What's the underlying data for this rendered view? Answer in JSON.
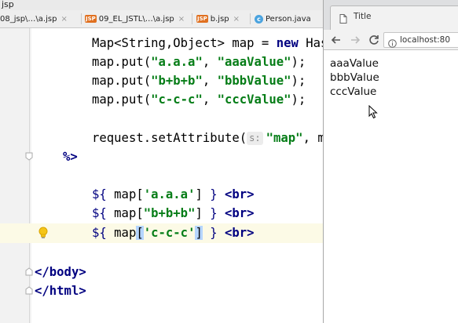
{
  "ide": {
    "window_title": "jsp",
    "tabs": [
      {
        "label": "08_jsp\\…\\a.jsp",
        "type": "jsp"
      },
      {
        "label": "09_EL_JSTL\\…\\a.jsp",
        "type": "jsp"
      },
      {
        "label": "b.jsp",
        "type": "jsp"
      },
      {
        "label": "Person.java",
        "type": "class"
      }
    ],
    "tab_icon_text": "JSP",
    "class_icon_text": "c",
    "close_glyph": "×",
    "code": {
      "l1_a": "Map<String,Object> map = ",
      "l1_kw": "new",
      "l1_b": " Has",
      "l2_a": "map.put(",
      "l2_s1": "\"a.a.a\"",
      "l2_b": ", ",
      "l2_s2": "\"aaaValue\"",
      "l2_c": ");",
      "l3_a": "map.put(",
      "l3_s1": "\"b+b+b\"",
      "l3_b": ", ",
      "l3_s2": "\"bbbValue\"",
      "l3_c": ");",
      "l4_a": "map.put(",
      "l4_s1": "\"c-c-c\"",
      "l4_b": ", ",
      "l4_s2": "\"cccValue\"",
      "l4_c": ");",
      "l5_a": "request.setAttribute(",
      "l5_hint": "s:",
      "l5_s1": "\"map\"",
      "l5_b": ", m",
      "l6": "%>",
      "l7_a": "${",
      "l7_b": " map[",
      "l7_s": "'a.a.a'",
      "l7_c": "] ",
      "l7_d": "}",
      "l7_tag": " <br>",
      "l8_a": "${",
      "l8_b": " map[",
      "l8_s": "\"b+b+b\"",
      "l8_c": "] ",
      "l8_d": "}",
      "l8_tag": " <br>",
      "l9_a": "${",
      "l9_b": " map",
      "l9_br1": "[",
      "l9_s": "'c-c-c'",
      "l9_br2": "]",
      "l9_c": " ",
      "l9_d": "}",
      "l9_tag": " <br>",
      "l10": "</body>",
      "l11": "</html>"
    }
  },
  "browser": {
    "tab_title": "Title",
    "url": "localhost:80",
    "output_lines": [
      "aaaValue",
      "bbbValue",
      "cccValue"
    ]
  },
  "icons": {
    "page": "page-icon",
    "back": "back-arrow-icon",
    "forward": "forward-arrow-icon",
    "reload": "reload-icon",
    "info": "info-icon",
    "bulb": "lightbulb-icon",
    "cursor": "mouse-pointer-icon"
  },
  "colors": {
    "string": "#067d17",
    "keyword": "#000080",
    "highlight_line": "#fcfae6",
    "bracket_match": "#b5d5ff",
    "gutter": "#f2f2f2"
  }
}
